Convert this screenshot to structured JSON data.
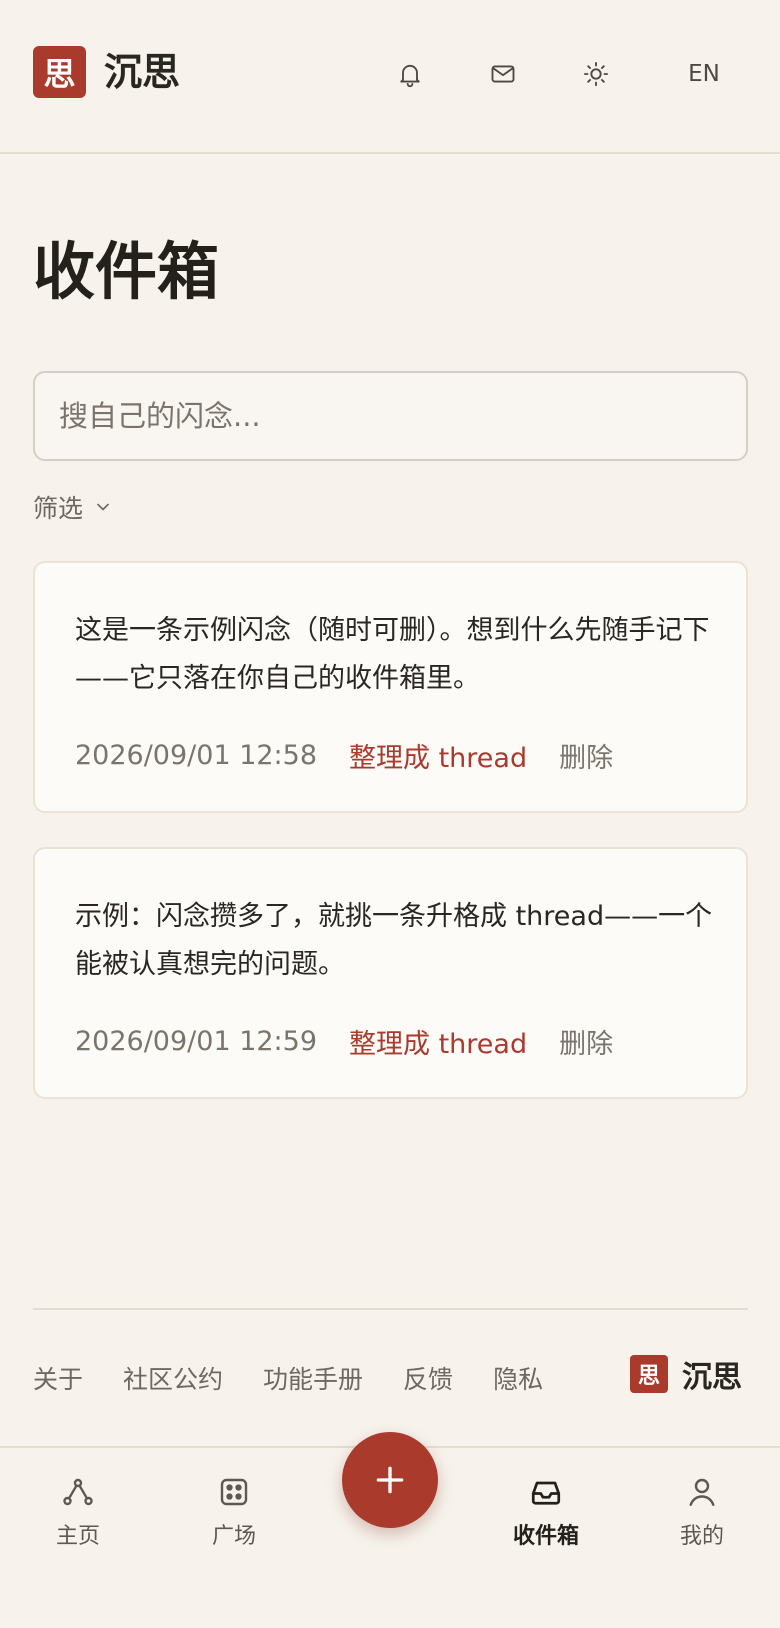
{
  "header": {
    "logo_glyph": "思",
    "brand_name": "沉思",
    "icons": [
      "bell-icon",
      "mail-icon",
      "sun-icon"
    ],
    "lang_label": "EN"
  },
  "page": {
    "title": "收件箱"
  },
  "search": {
    "placeholder": "搜自己的闪念..."
  },
  "filter": {
    "label": "筛选"
  },
  "cards": [
    {
      "text": "这是一条示例闪念（随时可删）。想到什么先随手记下——它只落在你自己的收件箱里。",
      "time": "2026/09/01 12:58",
      "organize_label": "整理成 thread",
      "delete_label": "删除"
    },
    {
      "text": "示例：闪念攒多了，就挑一条升格成 thread——一个能被认真想完的问题。",
      "time": "2026/09/01 12:59",
      "organize_label": "整理成 thread",
      "delete_label": "删除"
    }
  ],
  "footer": {
    "links": [
      "关于",
      "社区公约",
      "功能手册",
      "反馈",
      "隐私"
    ],
    "logo_glyph": "思",
    "brand_name": "沉思"
  },
  "bottom_nav": {
    "items": [
      {
        "label": "主页",
        "icon": "graph-icon"
      },
      {
        "label": "广场",
        "icon": "dice-icon"
      },
      {
        "label": "收件箱",
        "icon": "inbox-icon",
        "active": true
      },
      {
        "label": "我的",
        "icon": "user-icon"
      }
    ],
    "fab_icon": "plus-icon"
  },
  "colors": {
    "accent": "#a93a2c",
    "background": "#f7f3ec",
    "card_background": "#fcfbf8"
  }
}
